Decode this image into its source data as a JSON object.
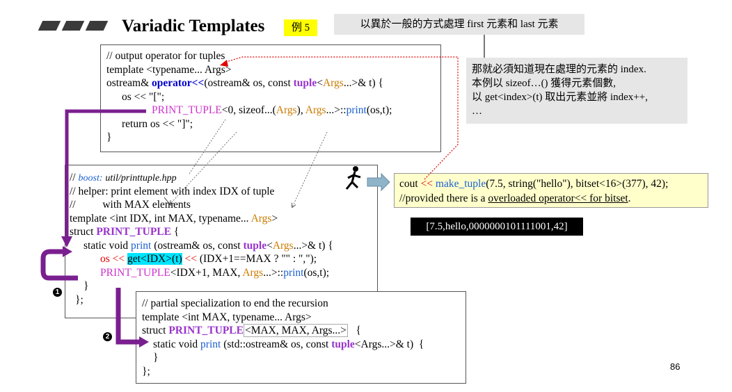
{
  "header": {
    "title": "Variadic Templates",
    "badge": "例 5",
    "note": "以異於一般的方式處理 first 元素和 last 元素"
  },
  "side_note": [
    "那就必須知道現在處理的元素的 index.",
    "本例以 sizeof…() 獲得元素個數,",
    "以 get<index>(t) 取出元素並將 index++,",
    "…"
  ],
  "box1": {
    "l1": "// output operator for tuples",
    "l2": "template <typename... Args>",
    "l3a": "ostream& ",
    "l3b": "operator<<",
    "l3c": "(ostream& os, const ",
    "l3d": "tuple",
    "l3e": "<",
    "l3f": "Args",
    "l3g": "...>& t) {",
    "l4": "os << \"[\";",
    "l5a": "PRINT_TUPLE",
    "l5b": "<0, sizeof...(",
    "l5c": "Args",
    "l5d": "), ",
    "l5e": "Args",
    "l5f": "...>::",
    "l5g": "print",
    "l5h": "(os,t);",
    "l6": "return os << \"]\";",
    "l7": "}"
  },
  "box2": {
    "l1a": "// ",
    "l1b": "boost:",
    "l1c": "util/printtuple.hpp",
    "l2": "// helper: print element with index IDX of tuple",
    "l3": "//          with MAX elements",
    "l4a": "template <int IDX, int MAX, typename... ",
    "l4b": "Args",
    "l4c": ">",
    "l5a": "struct ",
    "l5b": "PRINT_TUPLE",
    "l5c": " {",
    "l6a": "static void ",
    "l6b": "print",
    "l6c": " (ostream& os, const ",
    "l6d": "tuple",
    "l6e": "<",
    "l6f": "Args",
    "l6g": "...>& t) {",
    "l7a": "os << ",
    "l7b": "get<IDX>(t)",
    "l7c": " << ",
    "l7d": "(IDX+1==MAX ? \"\" : \",\");",
    "l8a": "PRINT_TUPLE",
    "l8b": "<IDX+1, MAX, ",
    "l8c": "Args",
    "l8d": "...>::",
    "l8e": "print",
    "l8f": "(os,t);",
    "l9": "}",
    "l10": "};"
  },
  "box3": {
    "l1": "// partial specialization to end the recursion",
    "l2": "template <int MAX, typename... Args>",
    "l3a": "struct ",
    "l3b": "PRINT_TUPLE",
    "l3c": "<MAX, MAX, Args...>",
    "l3d": "   {",
    "l4a": "static void ",
    "l4b": "print",
    "l4c": " (std::ostream& os, const ",
    "l4d": "tuple",
    "l4e": "<Args...>& t)  {",
    "l5": "}",
    "l6": "};"
  },
  "usage": {
    "l1a": "cout ",
    "l1b": "<<",
    "l1c": " ",
    "l1d": "make_tuple",
    "l1e": "(7.5, string(\"hello\"), bitset<16>(377), 42);",
    "l2a": "//provided there is a ",
    "l2b": "overloaded operator<< for bitset",
    "l2c": "."
  },
  "result": "[7.5,hello,0000000101111001,42]",
  "steps": [
    "1",
    "2"
  ],
  "page_number": "86",
  "colors": {
    "purple_arrow": "#7a1f8f",
    "keyword_purple": "#9933cc",
    "keyword_blue": "#0000cc",
    "args_orange": "#cc7a00",
    "highlight_cyan": "#00e5ff",
    "red_dotted": "#e00000",
    "note_gray": "#e6e6e6",
    "usage_yellow": "#ffffcc",
    "badge_yellow": "#ffff00"
  }
}
